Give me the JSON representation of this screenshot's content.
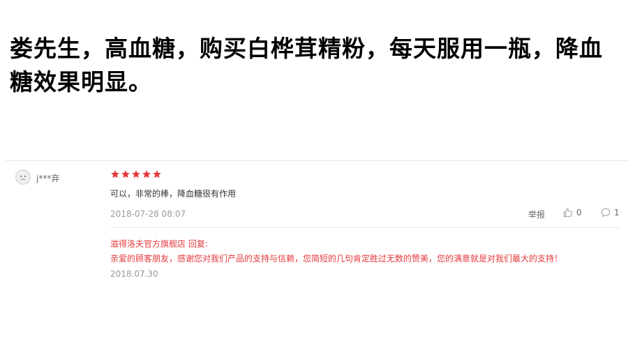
{
  "headline": "娄先生，高血糖，购买白桦茸精粉，每天服用一瓶，降血糖效果明显。",
  "review": {
    "username": "j***弃",
    "rating": 5,
    "rating_max": 5,
    "text": "可以，非常的棒，降血糖很有作用",
    "date": "2018-07-28 08:07",
    "report_label": "举报",
    "like_count": "0",
    "comment_count": "1"
  },
  "reply": {
    "title": "滋得洛夫官方旗舰店 回复:",
    "text": "亲爱的顾客朋友，感谢您对我们产品的支持与信赖，您简短的几句肯定胜过无数的赞美，您的满意就是对我们最大的支持！",
    "date": "2018.07.30"
  },
  "colors": {
    "star": "#e4393c",
    "reply_text": "#e4393c",
    "muted_text": "#999999"
  },
  "icons": {
    "avatar": "default-avatar-icon",
    "star": "star-icon",
    "like": "thumbs-up-icon",
    "comment": "comment-bubble-icon"
  }
}
